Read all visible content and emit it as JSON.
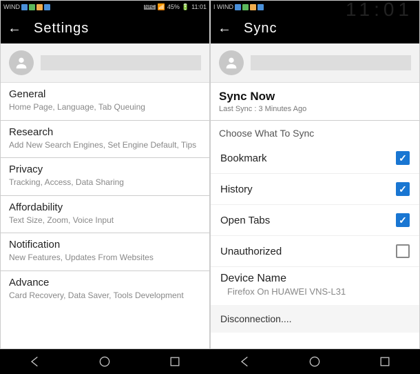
{
  "status": {
    "carrier": "WIND",
    "battery": "45%",
    "time": "11:01",
    "carrier2": "I WIND"
  },
  "clock_big": "11:01",
  "left": {
    "title": "Settings",
    "sections": [
      {
        "title": "General",
        "sub": "Home Page, Language, Tab Queuing"
      },
      {
        "title": "Research",
        "sub": "Add New Search Engines, Set Engine Default, Tips"
      },
      {
        "title": "Privacy",
        "sub": "Tracking, Access, Data Sharing"
      },
      {
        "title": "Affordability",
        "sub": "Text Size, Zoom, Voice Input"
      },
      {
        "title": "Notification",
        "sub": "New Features, Updates From Websites"
      },
      {
        "title": "Advance",
        "sub": "Card Recovery, Data Saver, Tools Development"
      }
    ]
  },
  "right": {
    "title": "Sync",
    "sync_now": "Sync Now",
    "last_sync": "Last Sync : 3 Minutes Ago",
    "choose": "Choose What To Sync",
    "items": [
      {
        "label": "Bookmark",
        "checked": true
      },
      {
        "label": "History",
        "checked": true
      },
      {
        "label": "Open Tabs",
        "checked": true
      },
      {
        "label": "Unauthorized",
        "checked": false
      }
    ],
    "device_title": "Device Name",
    "device_value": "Firefox On HUAWEI VNS-L31",
    "disconnect": "Disconnection...."
  }
}
